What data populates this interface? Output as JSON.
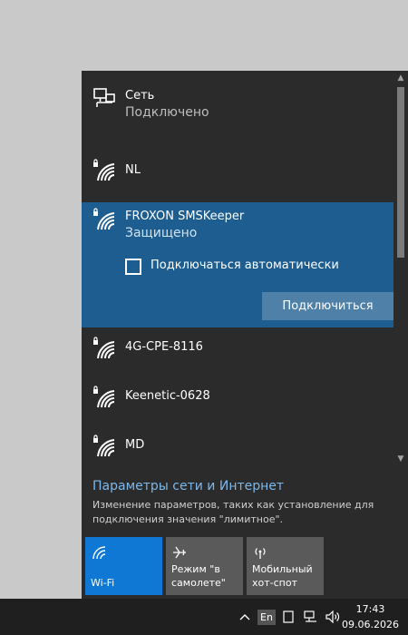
{
  "networks": {
    "wired": {
      "name": "Сеть",
      "status": "Подключено"
    },
    "items": [
      {
        "name": "NL"
      },
      {
        "name": "FROXON SMSKeeper",
        "status": "Защищено",
        "auto_connect_label": "Подключаться автоматически",
        "connect_label": "Подключиться",
        "auto_connect_checked": false
      },
      {
        "name": "4G-CPE-8116"
      },
      {
        "name": "Keenetic-0628"
      },
      {
        "name": "MD"
      }
    ]
  },
  "settings": {
    "link_label": "Параметры сети и Интернет",
    "description": "Изменение параметров, таких как установление для подключения значения \"лимитное\"."
  },
  "tiles": [
    {
      "label": "Wi-Fi",
      "active": true
    },
    {
      "label": "Режим \"в самолете\"",
      "active": false
    },
    {
      "label": "Мобильный хот-спот",
      "active": false
    }
  ],
  "taskbar": {
    "language": "En",
    "time": "17:43",
    "date": "09.06.2026"
  },
  "colors": {
    "flyout_bg": "#2b2b2b",
    "selected_bg": "#1e5d8f",
    "accent": "#0f78d4",
    "link": "#7cb8ea"
  }
}
